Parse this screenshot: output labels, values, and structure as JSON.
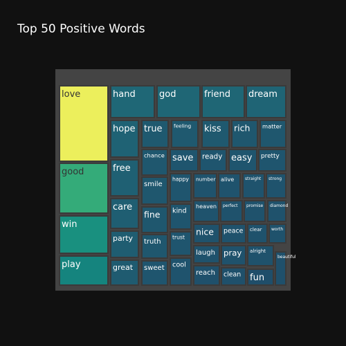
{
  "chart_data": {
    "type": "treemap",
    "title": "Top 50 Positive Words",
    "root": "",
    "colorscale": [
      "#1f4e6a",
      "#1f6b78",
      "#13877f",
      "#22a07f",
      "#52bd6e",
      "#a8d64e",
      "#ecef5c"
    ],
    "items": [
      {
        "label": "love",
        "value": 100
      },
      {
        "label": "good",
        "value": 58
      },
      {
        "label": "win",
        "value": 42
      },
      {
        "label": "play",
        "value": 34
      },
      {
        "label": "hand",
        "value": 18
      },
      {
        "label": "god",
        "value": 17
      },
      {
        "label": "friend",
        "value": 17
      },
      {
        "label": "dream",
        "value": 16
      },
      {
        "label": "hope",
        "value": 15
      },
      {
        "label": "free",
        "value": 14
      },
      {
        "label": "care",
        "value": 13
      },
      {
        "label": "party",
        "value": 12
      },
      {
        "label": "great",
        "value": 11
      },
      {
        "label": "true",
        "value": 10
      },
      {
        "label": "feeling",
        "value": 10
      },
      {
        "label": "kiss",
        "value": 10
      },
      {
        "label": "rich",
        "value": 9
      },
      {
        "label": "matter",
        "value": 9
      },
      {
        "label": "chance",
        "value": 9
      },
      {
        "label": "smile",
        "value": 9
      },
      {
        "label": "fine",
        "value": 9
      },
      {
        "label": "truth",
        "value": 9
      },
      {
        "label": "sweet",
        "value": 8
      },
      {
        "label": "save",
        "value": 8
      },
      {
        "label": "ready",
        "value": 8
      },
      {
        "label": "easy",
        "value": 8
      },
      {
        "label": "pretty",
        "value": 8
      },
      {
        "label": "happy",
        "value": 8
      },
      {
        "label": "kind",
        "value": 8
      },
      {
        "label": "trust",
        "value": 8
      },
      {
        "label": "cool",
        "value": 7
      },
      {
        "label": "number",
        "value": 7
      },
      {
        "label": "alive",
        "value": 7
      },
      {
        "label": "straight",
        "value": 7
      },
      {
        "label": "strong",
        "value": 7
      },
      {
        "label": "heaven",
        "value": 7
      },
      {
        "label": "perfect",
        "value": 6
      },
      {
        "label": "promise",
        "value": 6
      },
      {
        "label": "diamond",
        "value": 6
      },
      {
        "label": "nice",
        "value": 6
      },
      {
        "label": "peace",
        "value": 6
      },
      {
        "label": "clear",
        "value": 6
      },
      {
        "label": "worth",
        "value": 6
      },
      {
        "label": "laugh",
        "value": 6
      },
      {
        "label": "pray",
        "value": 6
      },
      {
        "label": "alright",
        "value": 6
      },
      {
        "label": "beautiful",
        "value": 5
      },
      {
        "label": "reach",
        "value": 5
      },
      {
        "label": "clean",
        "value": 5
      },
      {
        "label": "fun",
        "value": 4
      }
    ]
  }
}
